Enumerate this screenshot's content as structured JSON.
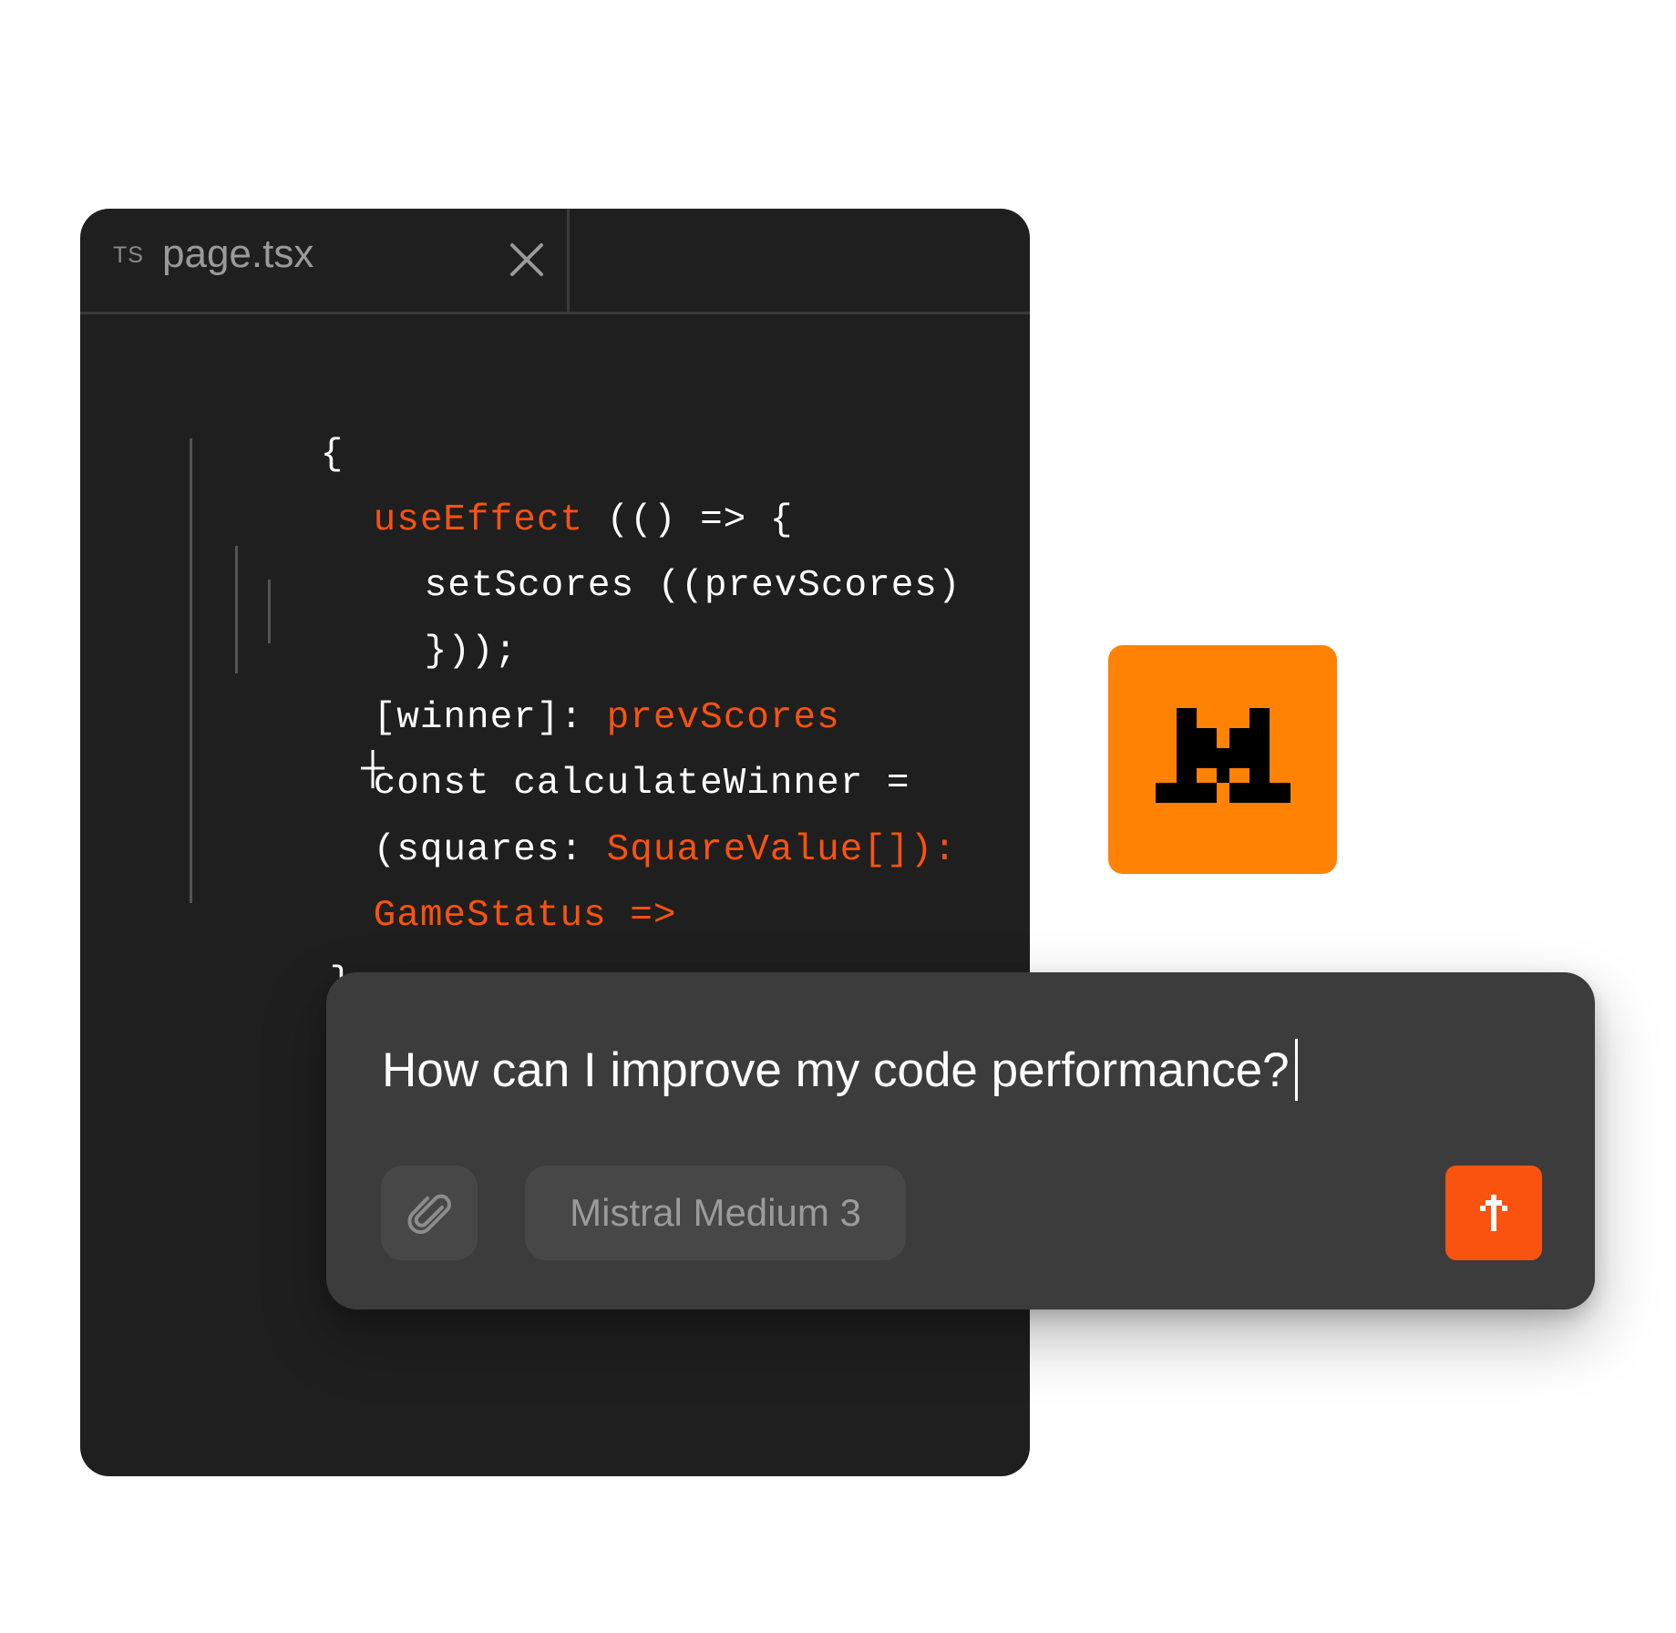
{
  "editor": {
    "tab": {
      "language_badge": "TS",
      "filename": "page.tsx",
      "close_icon": "close-icon"
    },
    "code_lines": [
      {
        "plain": "{",
        "keyword": ""
      },
      {
        "keyword": "useEffect",
        "plain": " (() => {"
      },
      {
        "plain": "setScores ((prevScores)",
        "keyword": ""
      },
      {
        "plain": "}));",
        "keyword": ""
      },
      {
        "plain": "[winner]: ",
        "keyword": "prevScores"
      },
      {
        "plain": "const calculateWinner =",
        "keyword": ""
      },
      {
        "plain": "(squares: ",
        "keyword": "SquareValue[]):"
      },
      {
        "plain": "",
        "keyword": "GameStatus =>"
      },
      {
        "plain": "}",
        "keyword": ""
      }
    ],
    "keyword_color": "#fa520f"
  },
  "logo": {
    "icon": "mistral-logo-icon",
    "color": "#ff8205"
  },
  "chat": {
    "prompt_text": "How can I improve my code performance?",
    "attach_icon": "paperclip-icon",
    "model_label": "Mistral Medium 3",
    "send_icon": "arrow-up-icon",
    "send_color": "#fa520f"
  }
}
